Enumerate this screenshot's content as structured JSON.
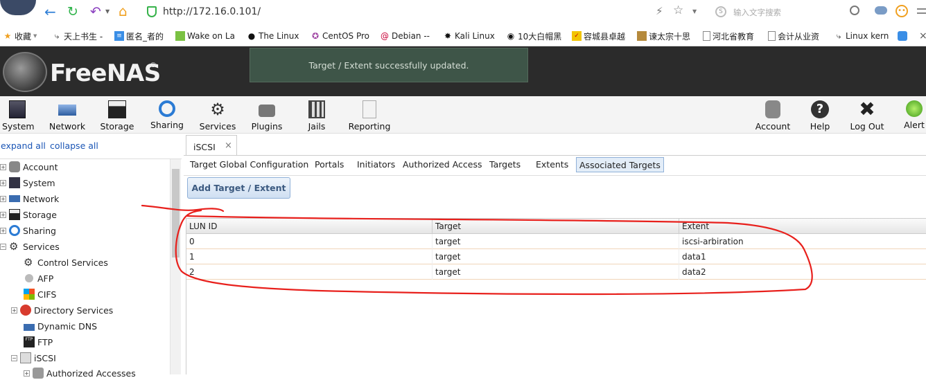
{
  "browser": {
    "url": "http://172.16.0.101/",
    "search_placeholder": "输入文字搜索"
  },
  "bookmarks": [
    {
      "label": "收藏",
      "icon": "star-icon"
    },
    {
      "label": "天上书生 -",
      "icon": "script-icon"
    },
    {
      "label": "匿名_者的",
      "icon": "bookmark-blue-icon"
    },
    {
      "label": "Wake on La",
      "icon": "green-square-icon"
    },
    {
      "label": "The Linux",
      "icon": "penguin-icon"
    },
    {
      "label": "CentOS Pro",
      "icon": "centos-icon"
    },
    {
      "label": "Debian --",
      "icon": "debian-icon"
    },
    {
      "label": "Kali Linux",
      "icon": "kali-icon"
    },
    {
      "label": "10大白帽黑",
      "icon": "hat-icon"
    },
    {
      "label": "容城县卓越",
      "icon": "yellow-logo-icon"
    },
    {
      "label": "谏太宗十思",
      "icon": "book-icon"
    },
    {
      "label": "河北省教育",
      "icon": "page-icon"
    },
    {
      "label": "会计从业资",
      "icon": "page-icon"
    },
    {
      "label": "Linux kern",
      "icon": "linux-kern-icon"
    }
  ],
  "notification": "Target / Extent successfully updated.",
  "brand": "FreeNAS",
  "toolbar_left": [
    {
      "label": "System",
      "icon": "system-icon"
    },
    {
      "label": "Network",
      "icon": "network-icon"
    },
    {
      "label": "Storage",
      "icon": "storage-icon"
    },
    {
      "label": "Sharing",
      "icon": "sharing-icon"
    },
    {
      "label": "Services",
      "icon": "services-icon"
    },
    {
      "label": "Plugins",
      "icon": "plugins-icon"
    },
    {
      "label": "Jails",
      "icon": "jails-icon"
    },
    {
      "label": "Reporting",
      "icon": "reporting-icon"
    }
  ],
  "toolbar_right": [
    {
      "label": "Account",
      "icon": "account-icon"
    },
    {
      "label": "Help",
      "icon": "help-icon"
    },
    {
      "label": "Log Out",
      "icon": "logout-icon"
    },
    {
      "label": "Alert",
      "icon": "alert-icon"
    }
  ],
  "tree": {
    "expand_all": "expand all",
    "collapse_all": "collapse all",
    "items": [
      {
        "label": "Account"
      },
      {
        "label": "System"
      },
      {
        "label": "Network"
      },
      {
        "label": "Storage"
      },
      {
        "label": "Sharing"
      },
      {
        "label": "Services"
      },
      {
        "label": "Control Services"
      },
      {
        "label": "AFP"
      },
      {
        "label": "CIFS"
      },
      {
        "label": "Directory Services"
      },
      {
        "label": "Dynamic DNS"
      },
      {
        "label": "FTP"
      },
      {
        "label": "iSCSI"
      },
      {
        "label": "Authorized Accesses"
      }
    ]
  },
  "main": {
    "tab_title": "iSCSI",
    "sub_tabs": [
      "Target Global Configuration",
      "Portals",
      "Initiators",
      "Authorized Access",
      "Targets",
      "Extents",
      "Associated Targets"
    ],
    "add_button": "Add Target / Extent",
    "table": {
      "columns": [
        "LUN ID",
        "Target",
        "Extent"
      ],
      "rows": [
        [
          "0",
          "target",
          "iscsi-arbiration"
        ],
        [
          "1",
          "target",
          "data1"
        ],
        [
          "2",
          "target",
          "data2"
        ]
      ]
    }
  },
  "colors": {
    "annotation": "#e8201c",
    "notification_bg": "#3e5548",
    "header_bg": "#2b2b2b"
  }
}
